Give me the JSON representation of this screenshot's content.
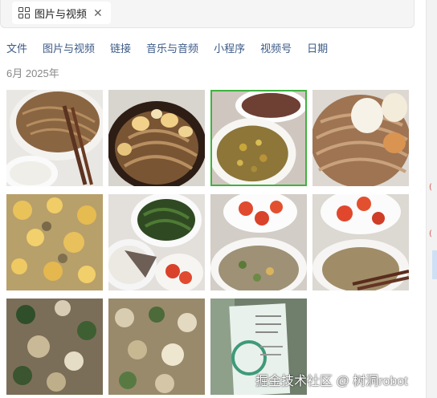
{
  "search": {
    "chip_label": "图片与视频",
    "chip_icon": "grid-icon",
    "close_icon": "close-icon"
  },
  "tabs": [
    {
      "label": "文件"
    },
    {
      "label": "图片与视频"
    },
    {
      "label": "链接"
    },
    {
      "label": "音乐与音频"
    },
    {
      "label": "小程序"
    },
    {
      "label": "视频号"
    },
    {
      "label": "日期"
    }
  ],
  "gallery": {
    "date_header": "6月 2025年",
    "selected_index": 2,
    "item_count": 11
  },
  "edge_marks": [
    "(",
    "("
  ],
  "watermark": "掘金技术社区 @ 树洞robot",
  "colors": {
    "tab_text": "#3c5a86",
    "selected_border": "#3fb33f"
  }
}
